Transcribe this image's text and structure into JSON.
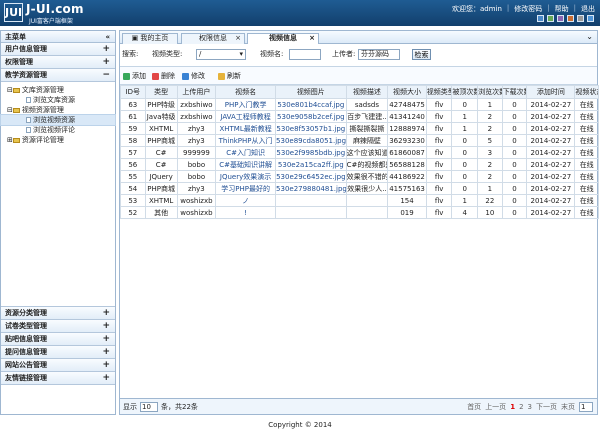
{
  "header": {
    "logo_badge": "JUI",
    "logo_title": "J-UI.com",
    "logo_sub": "JUI富客户端框架",
    "welcome": "欢迎您：admin",
    "change_password": "修改密码",
    "help": "帮助",
    "logout": "退出"
  },
  "sidebar": {
    "title": "主菜单",
    "collapse": "«",
    "accordions": [
      {
        "label": "用户信息管理",
        "toggle": "+"
      },
      {
        "label": "权限管理",
        "toggle": "+"
      },
      {
        "label": "教学资源管理",
        "toggle": "−"
      },
      {
        "label": "资源分类管理",
        "toggle": "+"
      },
      {
        "label": "试卷类型管理",
        "toggle": "+"
      },
      {
        "label": "贴吧信息管理",
        "toggle": "+"
      },
      {
        "label": "提问信息管理",
        "toggle": "+"
      },
      {
        "label": "网站公告管理",
        "toggle": "+"
      },
      {
        "label": "友情链接管理",
        "toggle": "+"
      }
    ],
    "tree": [
      {
        "label": "文库资源管理"
      },
      {
        "label": "浏览文库资源"
      },
      {
        "label": "视频资源管理"
      },
      {
        "label": "浏览视频资源"
      },
      {
        "label": "浏览视频评论"
      },
      {
        "label": "资源评论管理"
      }
    ]
  },
  "tabs": [
    {
      "label": "我的主页"
    },
    {
      "label": "权限信息"
    },
    {
      "label": "视频信息"
    }
  ],
  "search": {
    "label": "搜索:",
    "type_label": "视频类型:",
    "type_value": "/",
    "name_label": "视频名:",
    "uploader_label": "上传者:",
    "uploader_value": "芬芬源码",
    "button": "检索"
  },
  "toolbar": {
    "add": "添加",
    "delete": "删除",
    "edit": "修改",
    "refresh": "刷新"
  },
  "table": {
    "headers": [
      "ID号",
      "类型",
      "上传用户",
      "视频名",
      "视频图片",
      "视频描述",
      "视频大小",
      "视频类型",
      "被顶次数",
      "浏览次数",
      "下载次数",
      "添加时间",
      "视频状态"
    ],
    "rows": [
      [
        "63",
        "PHP特级",
        "zxbshiwo",
        "PHP入门教学",
        "530e801b4ccaf.jpg",
        "sadsds",
        "42748475",
        "flv",
        "0",
        "1",
        "0",
        "2014-02-27",
        "在线"
      ],
      [
        "61",
        "Java特级",
        "zxbshiwo",
        "JAVA工程师教程",
        "530e9058b2cef.jpg",
        "百步飞建建..",
        "41341240",
        "flv",
        "1",
        "2",
        "0",
        "2014-02-27",
        "在线"
      ],
      [
        "59",
        "XHTML",
        "zhy3",
        "XHTML最新教程",
        "530e8f53057b1.jpg",
        "撕裂撕裂撕",
        "12888974",
        "flv",
        "1",
        "2",
        "0",
        "2014-02-27",
        "在线"
      ],
      [
        "58",
        "PHP商城",
        "zhy3",
        "ThinkPHP从入门",
        "530e89cda8051.jpg",
        "麻辣隔壁",
        "36293230",
        "flv",
        "0",
        "5",
        "0",
        "2014-02-27",
        "在线"
      ],
      [
        "57",
        "C#",
        "999999",
        "C#入门知识",
        "530e2f9985bdb.jpg",
        "这个应该知道",
        "61860087",
        "flv",
        "0",
        "3",
        "0",
        "2014-02-27",
        "在线"
      ],
      [
        "56",
        "C#",
        "bobo",
        "C#基础知识讲解",
        "530e2a15ca2ff.jpg",
        "C#的视频都是",
        "56588128",
        "flv",
        "0",
        "2",
        "0",
        "2014-02-27",
        "在线"
      ],
      [
        "55",
        "JQuery",
        "bobo",
        "JQuery效果演示",
        "530e29c6452ec.jpg",
        "效果很不错的",
        "44186922",
        "flv",
        "0",
        "2",
        "0",
        "2014-02-27",
        "在线"
      ],
      [
        "54",
        "PHP商城",
        "zhy3",
        "学习PHP最好的",
        "530e279880481.jpg",
        "效果很少人..",
        "41575163",
        "flv",
        "0",
        "1",
        "0",
        "2014-02-27",
        "在线"
      ],
      [
        "53",
        "XHTML",
        "woshizxb",
        "ノ",
        "",
        "",
        "154",
        "flv",
        "1",
        "22",
        "0",
        "2014-02-27",
        "在线"
      ],
      [
        "52",
        "其他",
        "woshizxb",
        "!",
        "",
        "",
        "019",
        "flv",
        "4",
        "10",
        "0",
        "2014-02-27",
        "在线"
      ]
    ]
  },
  "pager": {
    "show": "显示",
    "size": "10",
    "summary": "条，共22条",
    "first": "首页",
    "prev": "上一页",
    "pages": [
      "1",
      "2",
      "3"
    ],
    "next": "下一页",
    "last": "末页",
    "jump": "1"
  },
  "footer": "Copyright © 2014",
  "colors": {
    "header": "#1f5c93",
    "panel_border": "#9fb7d1",
    "accent": "#204f94"
  }
}
